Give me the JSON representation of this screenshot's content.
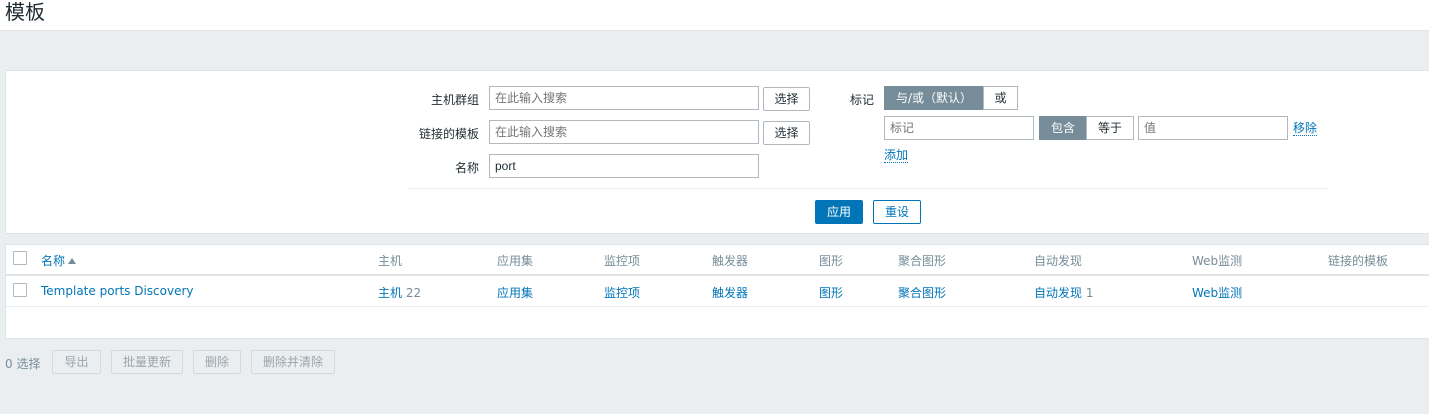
{
  "page": {
    "title": "模板"
  },
  "filter": {
    "host_groups": {
      "label": "主机群组",
      "placeholder": "在此输入搜索",
      "select_label": "选择"
    },
    "linked_templates": {
      "label": "链接的模板",
      "placeholder": "在此输入搜索",
      "select_label": "选择"
    },
    "name": {
      "label": "名称",
      "value": "port"
    },
    "tags": {
      "label": "标记",
      "operator_options": [
        "与/或（默认）",
        "或"
      ],
      "tag_placeholder": "标记",
      "match_options": [
        "包含",
        "等于"
      ],
      "value_placeholder": "值",
      "remove_label": "移除",
      "add_label": "添加"
    },
    "apply_label": "应用",
    "reset_label": "重设"
  },
  "table": {
    "columns": [
      "名称",
      "主机",
      "应用集",
      "监控项",
      "触发器",
      "图形",
      "聚合图形",
      "自动发现",
      "Web监测",
      "链接的模板"
    ],
    "rows": [
      {
        "name": "Template ports Discovery",
        "hosts": "主机",
        "hosts_count": "22",
        "applications": "应用集",
        "items": "监控项",
        "triggers": "触发器",
        "graphs": "图形",
        "screens": "聚合图形",
        "discovery": "自动发现",
        "discovery_count": "1",
        "web": "Web监测",
        "linked": ""
      }
    ]
  },
  "footer": {
    "selected": "0 选择",
    "buttons": [
      "导出",
      "批量更新",
      "删除",
      "删除并清除"
    ]
  },
  "colors": {
    "accent": "#0275b8",
    "segment_active": "#768d99",
    "background": "#ebeef0"
  }
}
